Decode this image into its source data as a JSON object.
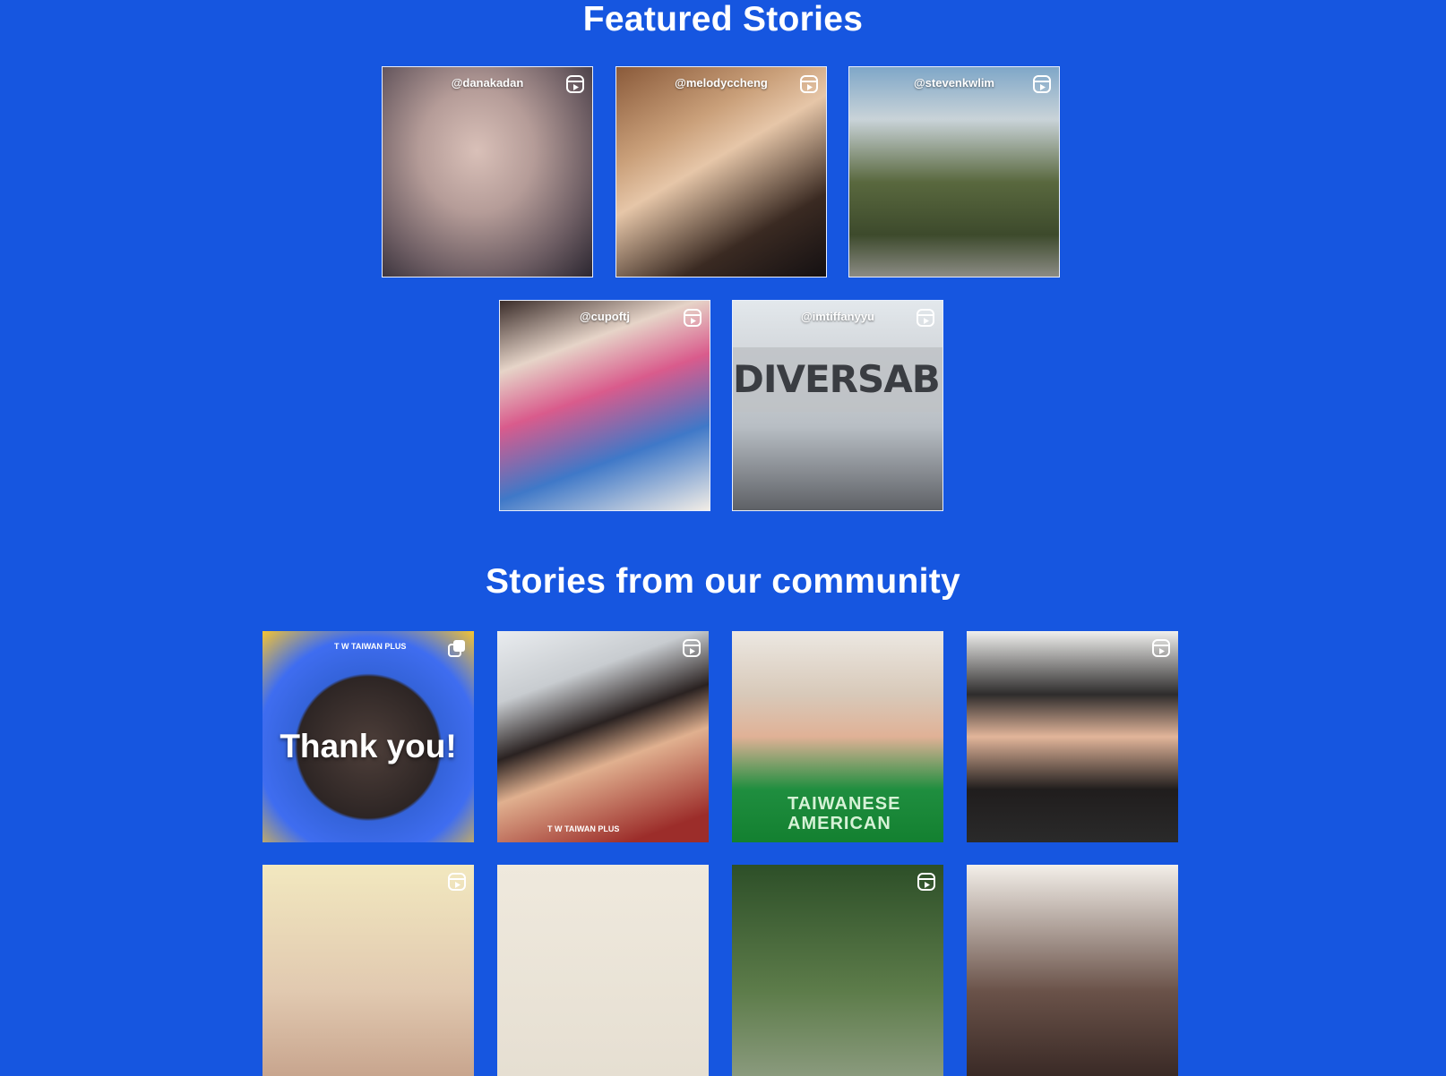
{
  "featured": {
    "title": "Featured Stories",
    "tiles": [
      {
        "handle": "@danakadan",
        "icon": "reel-icon"
      },
      {
        "handle": "@melodyccheng",
        "icon": "reel-icon"
      },
      {
        "handle": "@stevenkwlim",
        "icon": "reel-icon"
      },
      {
        "handle": "@cupoftj",
        "icon": "reel-icon"
      },
      {
        "handle": "@imtiffanyyu",
        "icon": "reel-icon",
        "sign_text": "DIVERSABILITY"
      }
    ]
  },
  "community": {
    "title": "Stories from our community",
    "tiles": [
      {
        "overlay_text": "Thank you!",
        "brand": "T W TAIWAN PLUS",
        "icon": "copy-icon"
      },
      {
        "brand": "T W TAIWAN PLUS",
        "icon": "reel-icon"
      },
      {
        "shirt_text": "TAIWANESE AMERICAN"
      },
      {
        "icon": "reel-icon"
      },
      {
        "icon": "reel-icon"
      },
      {},
      {
        "icon": "reel-icon"
      },
      {}
    ]
  },
  "colors": {
    "background": "#1656e0",
    "text": "#ffffff",
    "tile_border": "#e8eefc"
  }
}
